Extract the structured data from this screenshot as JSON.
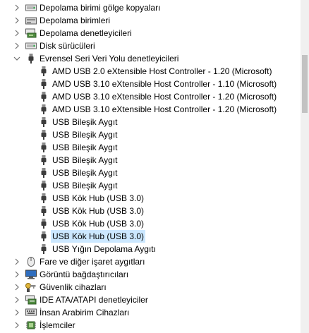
{
  "tree": {
    "items": [
      {
        "label": "Depolama birimi gölge kopyaları",
        "icon": "drive-icon",
        "expander": "collapsed",
        "level": 0
      },
      {
        "label": "Depolama birimleri",
        "icon": "volume-icon",
        "expander": "collapsed",
        "level": 0
      },
      {
        "label": "Depolama denetleyicileri",
        "icon": "storage-controller-icon",
        "expander": "collapsed",
        "level": 0
      },
      {
        "label": "Disk sürücüleri",
        "icon": "drive-icon",
        "expander": "collapsed",
        "level": 0
      },
      {
        "label": "Evrensel Seri Veri Yolu denetleyicileri",
        "icon": "usb-plug-icon",
        "expander": "expanded",
        "level": 0
      },
      {
        "label": "AMD USB 2.0 eXtensible Host Controller - 1.20 (Microsoft)",
        "icon": "usb-plug-icon",
        "level": 1
      },
      {
        "label": "AMD USB 3.10 eXtensible Host Controller - 1.10 (Microsoft)",
        "icon": "usb-plug-icon",
        "level": 1
      },
      {
        "label": "AMD USB 3.10 eXtensible Host Controller - 1.20 (Microsoft)",
        "icon": "usb-plug-icon",
        "level": 1
      },
      {
        "label": "AMD USB 3.10 eXtensible Host Controller - 1.20 (Microsoft)",
        "icon": "usb-plug-icon",
        "level": 1
      },
      {
        "label": "USB Bileşik Aygıt",
        "icon": "usb-plug-icon",
        "level": 1
      },
      {
        "label": "USB Bileşik Aygıt",
        "icon": "usb-plug-icon",
        "level": 1
      },
      {
        "label": "USB Bileşik Aygıt",
        "icon": "usb-plug-icon",
        "level": 1
      },
      {
        "label": "USB Bileşik Aygıt",
        "icon": "usb-plug-icon",
        "level": 1
      },
      {
        "label": "USB Bileşik Aygıt",
        "icon": "usb-plug-icon",
        "level": 1
      },
      {
        "label": "USB Bileşik Aygıt",
        "icon": "usb-plug-icon",
        "level": 1
      },
      {
        "label": "USB Kök Hub (USB 3.0)",
        "icon": "usb-plug-icon",
        "level": 1
      },
      {
        "label": "USB Kök Hub (USB 3.0)",
        "icon": "usb-plug-icon",
        "level": 1
      },
      {
        "label": "USB Kök Hub (USB 3.0)",
        "icon": "usb-plug-icon",
        "level": 1
      },
      {
        "label": "USB Kök Hub (USB 3.0)",
        "icon": "usb-plug-icon",
        "level": 1,
        "selected": true
      },
      {
        "label": "USB Yığın Depolama Aygıtı",
        "icon": "usb-plug-icon",
        "level": 1
      },
      {
        "label": "Fare ve diğer işaret aygıtları",
        "icon": "mouse-icon",
        "expander": "collapsed",
        "level": 0
      },
      {
        "label": "Görüntü bağdaştırıcıları",
        "icon": "display-adapter-icon",
        "expander": "collapsed",
        "level": 0
      },
      {
        "label": "Güvenlik cihazları",
        "icon": "security-key-icon",
        "expander": "collapsed",
        "level": 0
      },
      {
        "label": "IDE ATA/ATAPI denetleyiciler",
        "icon": "ide-controller-icon",
        "expander": "collapsed",
        "level": 0
      },
      {
        "label": "İnsan Arabirim Cihazları",
        "icon": "hid-icon",
        "expander": "collapsed",
        "level": 0
      },
      {
        "label": "İşlemciler",
        "icon": "processor-icon",
        "expander": "collapsed",
        "level": 0
      }
    ]
  },
  "colors": {
    "selection": "#cce8ff",
    "icon_dark": "#3c3c3c",
    "icon_light": "#8a8a8a",
    "expander": "#707070",
    "scrollbar_track": "#f0f0f0",
    "scrollbar_thumb": "#c2c2c2"
  }
}
